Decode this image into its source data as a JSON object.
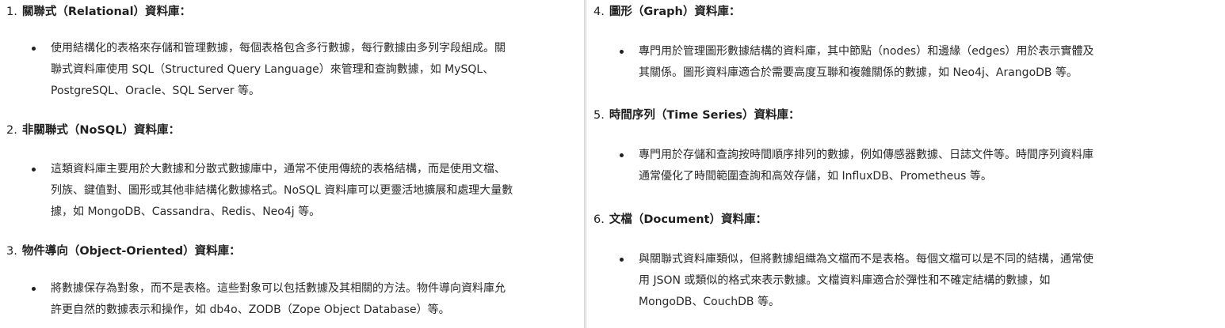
{
  "left": {
    "sections": [
      {
        "number": "1.",
        "title": "關聯式（Relational）資料庫：",
        "bullet_lines": [
          "使用結構化的表格來存儲和管理數據，每個表格包含多行數據，每行數據由多列字段組成。關",
          "聯式資料庫使用 SQL（Structured Query Language）來管理和查詢數據，如 MySQL、",
          "PostgreSQL、Oracle、SQL Server 等。"
        ]
      },
      {
        "number": "2.",
        "title": "非關聯式（NoSQL）資料庫：",
        "bullet_lines": [
          "這類資料庫主要用於大數據和分散式數據庫中，通常不使用傳統的表格結構，而是使用文檔、",
          "列族、鍵值對、圖形或其他非結構化數據格式。NoSQL 資料庫可以更靈活地擴展和處理大量數",
          "據，如 MongoDB、Cassandra、Redis、Neo4j 等。"
        ]
      },
      {
        "number": "3.",
        "title": "物件導向（Object-Oriented）資料庫：",
        "bullet_lines": [
          "將數據保存為對象，而不是表格。這些對象可以包括數據及其相關的方法。物件導向資料庫允",
          "許更自然的數據表示和操作，如 db4o、ZODB（Zope Object Database）等。"
        ]
      }
    ]
  },
  "right": {
    "sections": [
      {
        "number": "4.",
        "title": "圖形（Graph）資料庫：",
        "bullet_lines": [
          "專門用於管理圖形數據結構的資料庫，其中節點（nodes）和邊緣（edges）用於表示實體及",
          "其關係。圖形資料庫適合於需要高度互聯和複雜關係的數據，如 Neo4j、ArangoDB 等。"
        ]
      },
      {
        "number": "5.",
        "title": "時間序列（Time Series）資料庫：",
        "bullet_lines": [
          "專門用於存儲和查詢按時間順序排列的數據，例如傳感器數據、日誌文件等。時間序列資料庫",
          "通常優化了時間範圍查詢和高效存儲，如 InfluxDB、Prometheus 等。"
        ]
      },
      {
        "number": "6.",
        "title": "文檔（Document）資料庫：",
        "bullet_lines": [
          "與關聯式資料庫類似，但將數據組織為文檔而不是表格。每個文檔可以是不同的結構，通常使",
          "用 JSON 或類似的格式來表示數據。文檔資料庫適合於彈性和不確定結構的數據，如",
          "MongoDB、CouchDB 等。"
        ]
      }
    ]
  }
}
